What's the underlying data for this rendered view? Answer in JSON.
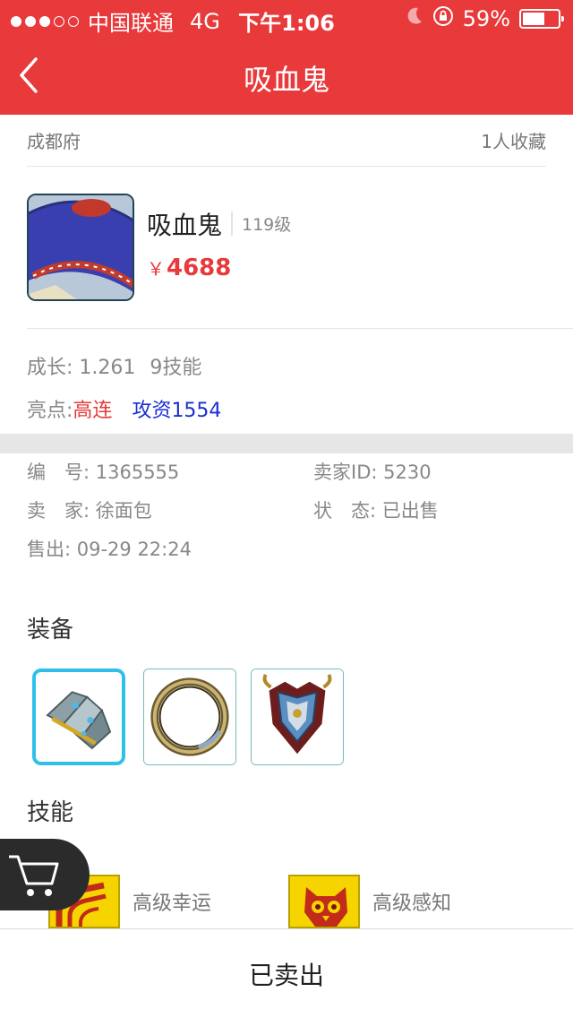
{
  "status_bar": {
    "carrier": "中国联通",
    "network": "4G",
    "time": "下午1:06",
    "battery": "59%",
    "signal_strength": 3,
    "signal_max": 5,
    "battery_level": 0.59
  },
  "nav": {
    "title": "吸血鬼",
    "back_icon": "chevron-left-icon"
  },
  "location": {
    "server": "成都府",
    "favorites": "1人收藏"
  },
  "pet": {
    "name": "吸血鬼",
    "level": "119级",
    "currency": "￥",
    "price": "4688"
  },
  "stats": {
    "growth": "成长: 1.261",
    "skills_count": "9技能",
    "highlight_label": "亮点:",
    "highlight_1": "高连",
    "highlight_2": "攻资1554"
  },
  "info": {
    "id": "编　号: 1365555",
    "seller_id": "卖家ID: 5230",
    "seller": "卖　家: 徐面包",
    "status": "状　态: 已出售",
    "sold": "售出: 09-29 22:24"
  },
  "equipment": {
    "title": "装备",
    "items": [
      {
        "name": "bracer-icon"
      },
      {
        "name": "ring-icon"
      },
      {
        "name": "armor-icon"
      }
    ]
  },
  "skills": {
    "title": "技能",
    "items": [
      {
        "label": "高级幸运",
        "icon": "luck-skill-icon"
      },
      {
        "label": "高级感知",
        "icon": "perception-skill-icon"
      }
    ]
  },
  "cart": {
    "icon": "cart-icon"
  },
  "bottom": {
    "action": "已卖出"
  },
  "colors": {
    "primary": "#e8393b",
    "blue_text": "#1a2fd0",
    "selected_border": "#2ec0ea"
  }
}
